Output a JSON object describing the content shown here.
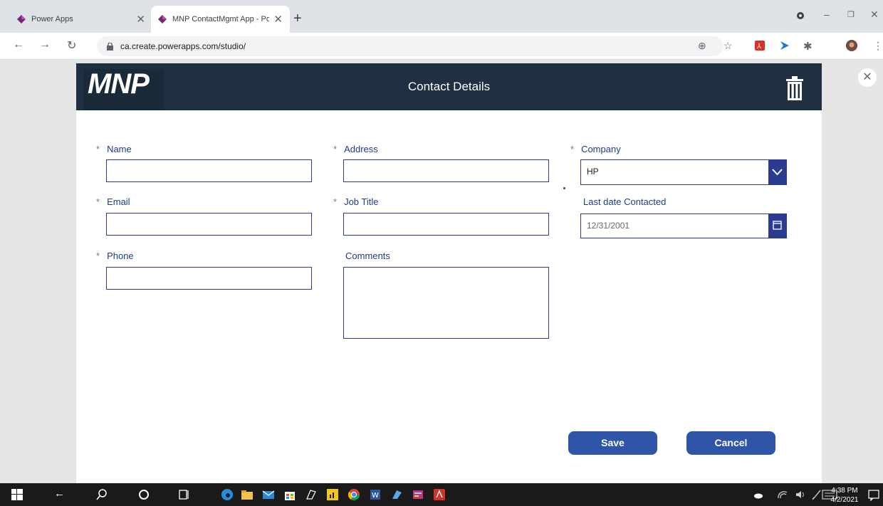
{
  "browser": {
    "tabs": [
      {
        "title": "Power Apps",
        "active": false
      },
      {
        "title": "MNP ContactMgmt App - Pow",
        "active": true
      }
    ],
    "url": "ca.create.powerapps.com/studio/"
  },
  "app": {
    "logo_text": "MNP",
    "title": "Contact Details",
    "colors": {
      "header": "#212f42",
      "accent": "#2b3b8f",
      "button": "#2f55a8"
    }
  },
  "form": {
    "name": {
      "label": "Name",
      "required": "*",
      "value": ""
    },
    "address": {
      "label": "Address",
      "required": "*",
      "value": ""
    },
    "company": {
      "label": "Company",
      "required": "*",
      "value": "HP"
    },
    "email": {
      "label": "Email",
      "required": "*",
      "value": ""
    },
    "job_title": {
      "label": "Job Title",
      "required": "*",
      "value": ""
    },
    "last_contacted": {
      "label": "Last date Contacted",
      "value": "12/31/2001"
    },
    "phone": {
      "label": "Phone",
      "required": "*",
      "value": ""
    },
    "comments": {
      "label": "Comments",
      "value": ""
    },
    "save_label": "Save",
    "cancel_label": "Cancel"
  },
  "taskbar": {
    "time": "4:38 PM",
    "date": "4/2/2021"
  }
}
